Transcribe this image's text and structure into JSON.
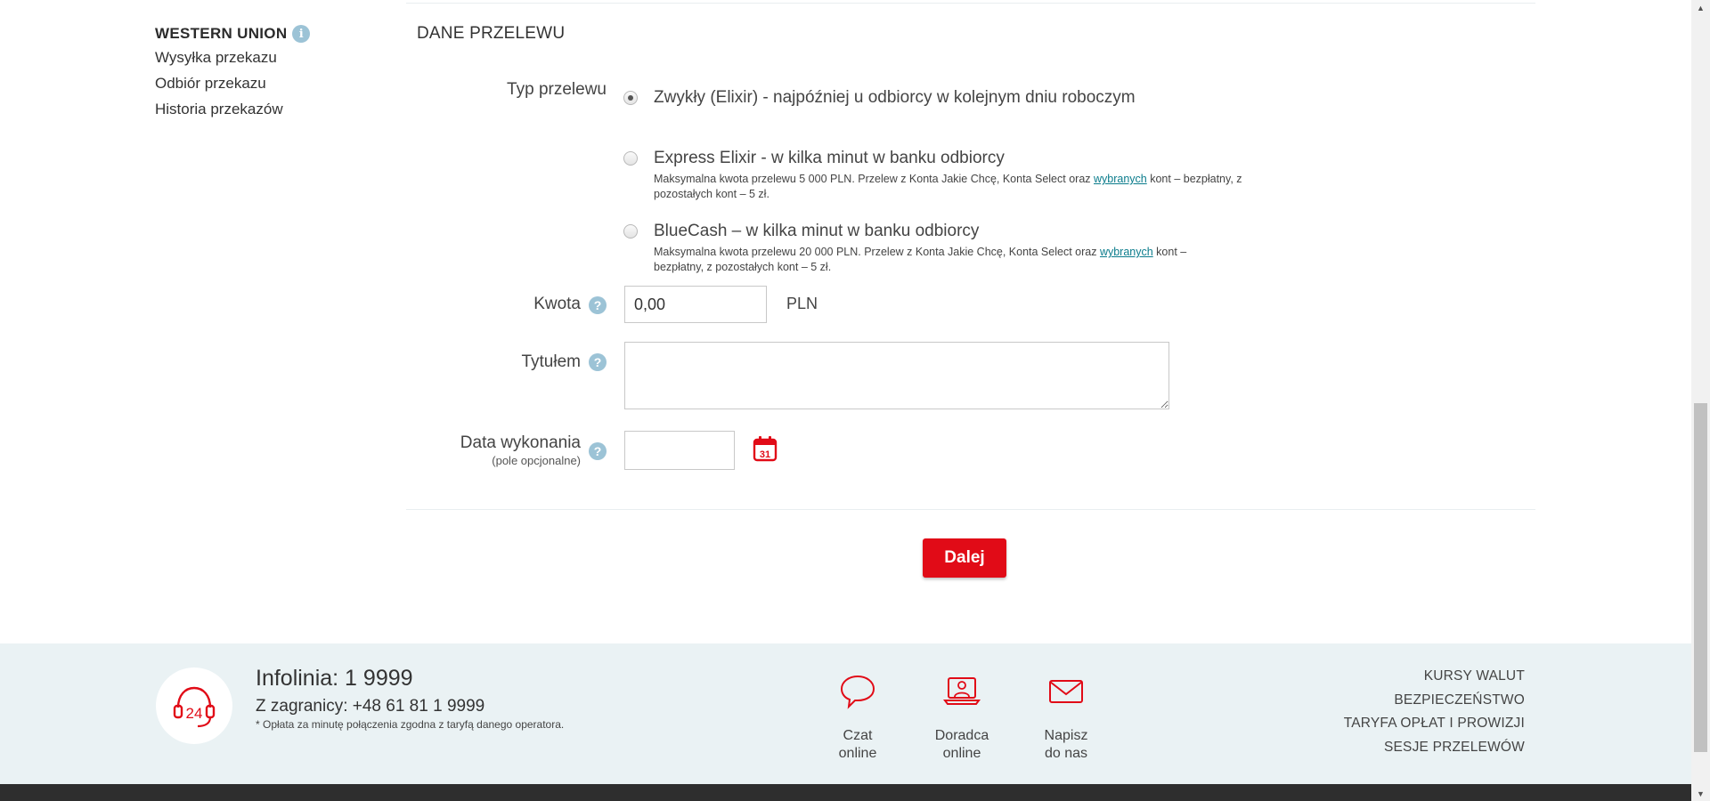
{
  "sidebar": {
    "heading": "WESTERN UNION",
    "info_icon": "i",
    "items": [
      {
        "label": "Wysyłka przekazu"
      },
      {
        "label": "Odbiór przekazu"
      },
      {
        "label": "Historia przekazów"
      }
    ]
  },
  "form": {
    "section_title": "DANE PRZELEWU",
    "type_label": "Typ przelewu",
    "options": [
      {
        "title": "Zwykły (Elixir) - najpóźniej u odbiorcy w kolejnym dniu roboczym",
        "checked": true
      },
      {
        "title": "Express Elixir - w kilka minut w banku odbiorcy",
        "desc_before": "Maksymalna kwota przelewu 5 000 PLN. Przelew z Konta Jakie Chcę, Konta Select oraz ",
        "desc_link": "wybranych",
        "desc_after": " kont – bezpłatny, z pozostałych kont – 5 zł.",
        "checked": false
      },
      {
        "title": "BlueCash – w kilka minut w banku odbiorcy",
        "desc_before": "Maksymalna kwota przelewu 20 000 PLN. Przelew z Konta Jakie Chcę, Konta Select oraz ",
        "desc_link": "wybranych",
        "desc_after": " kont – bezpłatny, z pozostałych kont – 5 zł.",
        "checked": false
      }
    ],
    "amount": {
      "label": "Kwota",
      "value": "0,00",
      "unit": "PLN"
    },
    "title_field": {
      "label": "Tytułem",
      "value": ""
    },
    "date": {
      "label": "Data wykonania",
      "sublabel": "(pole opcjonalne)",
      "value": "",
      "calendar_day": "31"
    },
    "help_icon": "?",
    "next_button": "Dalej"
  },
  "footer": {
    "phone_badge": "24",
    "infolinia": "Infolinia: 1 9999",
    "abroad": "Z zagranicy: +48 61 81 1 9999",
    "note": "* Opłata za minutę połączenia zgodna z taryfą danego operatora.",
    "contacts": [
      {
        "line1": "Czat",
        "line2": "online",
        "icon": "chat-icon"
      },
      {
        "line1": "Doradca",
        "line2": "online",
        "icon": "advisor-icon"
      },
      {
        "line1": "Napisz",
        "line2": "do nas",
        "icon": "mail-icon"
      }
    ],
    "links": [
      {
        "label": "KURSY WALUT"
      },
      {
        "label": "BEZPIECZEŃSTWO"
      },
      {
        "label": "TARYFA OPŁAT I PROWIZJI"
      },
      {
        "label": "SESJE PRZELEWÓW"
      }
    ]
  },
  "colors": {
    "accent_red": "#e10b17",
    "help_blue": "#9cc3d6",
    "footer_bg": "#eaf2f4",
    "link_teal": "#0b7c8c"
  }
}
